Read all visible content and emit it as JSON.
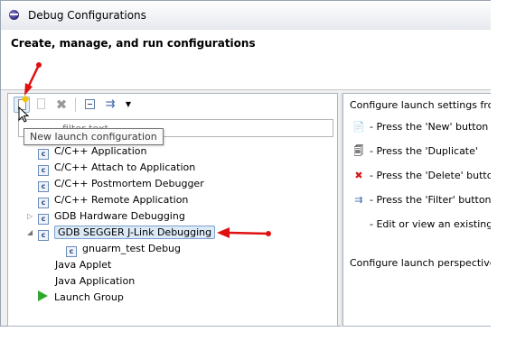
{
  "window": {
    "title": "Debug Configurations"
  },
  "header": {
    "title": "Create, manage, and run configurations"
  },
  "toolbar": {
    "new_icon": "new-config-icon",
    "duplicate_icon": "duplicate-icon",
    "delete_icon": "delete-icon",
    "collapse_icon": "collapse-all-icon",
    "filter_icon": "filter-icon",
    "menu_icon": "dropdown-icon"
  },
  "filter": {
    "placeholder": "filter text"
  },
  "tooltip": {
    "text": "New launch configuration"
  },
  "tree": {
    "items": [
      {
        "label": "C/C++ Application"
      },
      {
        "label": "C/C++ Attach to Application"
      },
      {
        "label": "C/C++ Postmortem Debugger"
      },
      {
        "label": "C/C++ Remote Application"
      },
      {
        "label": "GDB Hardware Debugging"
      },
      {
        "label": "GDB SEGGER J-Link Debugging"
      },
      {
        "label": "gnuarm_test Debug"
      },
      {
        "label": "Java Applet"
      },
      {
        "label": "Java Application"
      },
      {
        "label": "Launch Group"
      }
    ]
  },
  "right": {
    "heading": "Configure launch settings fron",
    "lines": [
      {
        "text": "- Press the 'New' button"
      },
      {
        "text": "- Press the 'Duplicate'"
      },
      {
        "text": "- Press the 'Delete' butto"
      },
      {
        "text": "- Press the 'Filter' button"
      },
      {
        "text": "- Edit or view an existing"
      }
    ],
    "footer": "Configure launch perspective s"
  },
  "colors": {
    "accent": "#e01010",
    "selection": "#dceaf8"
  }
}
